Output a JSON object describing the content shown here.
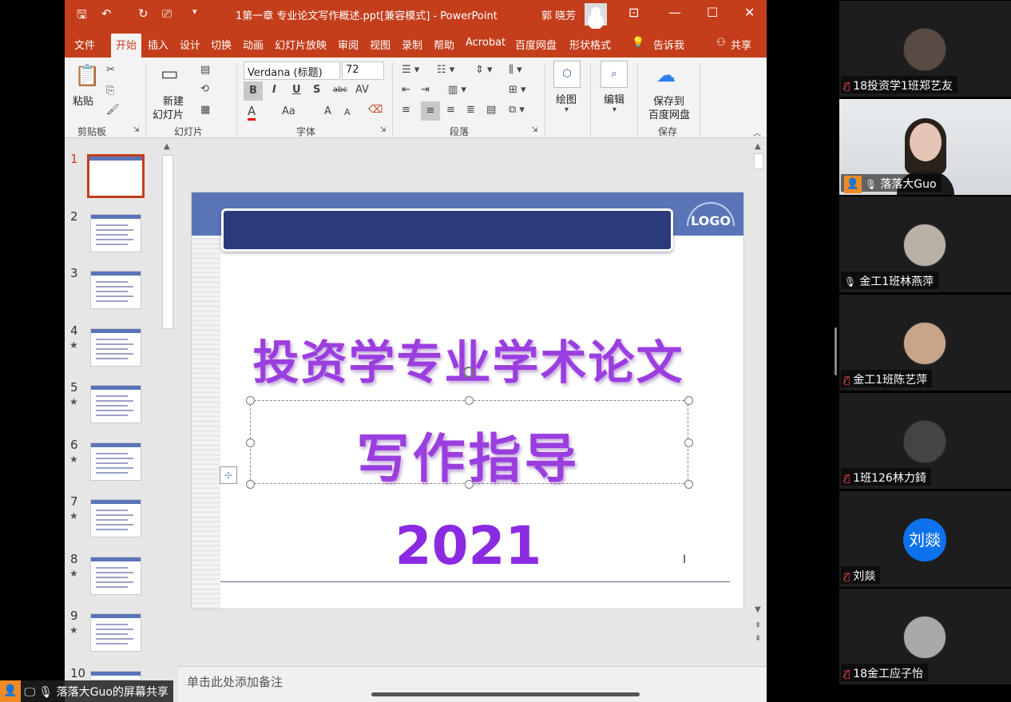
{
  "window": {
    "title": "1第一章 专业论文写作概述.ppt[兼容模式] - PowerPoint",
    "user_name": "郭 晓芳"
  },
  "ribbon_tabs": [
    "文件",
    "开始",
    "插入",
    "设计",
    "切换",
    "动画",
    "幻灯片放映",
    "审阅",
    "视图",
    "录制",
    "帮助",
    "Acrobat",
    "百度网盘",
    "形状格式"
  ],
  "tell_me": "告诉我",
  "share": "共享",
  "ribbon": {
    "clipboard": {
      "paste": "粘贴",
      "label": "剪贴板"
    },
    "slides": {
      "new_slide_line1": "新建",
      "new_slide_line2": "幻灯片",
      "label": "幻灯片"
    },
    "font": {
      "font_name": "Verdana (标题)",
      "font_size": "72",
      "bold": "B",
      "italic": "I",
      "underline": "U",
      "shadow": "S",
      "strike": "abc",
      "spacing": "AV",
      "color": "A",
      "case": "Aa",
      "grow": "A",
      "shrink": "A",
      "label": "字体"
    },
    "paragraph": {
      "label": "段落"
    },
    "drawing": {
      "label": "绘图"
    },
    "editing": {
      "label": "编辑"
    },
    "save": {
      "line1": "保存到",
      "line2": "百度网盘",
      "label": "保存"
    }
  },
  "thumbnails": [
    {
      "num": "1",
      "star": ""
    },
    {
      "num": "2",
      "star": ""
    },
    {
      "num": "3",
      "star": ""
    },
    {
      "num": "4",
      "star": "★"
    },
    {
      "num": "5",
      "star": "★"
    },
    {
      "num": "6",
      "star": "★"
    },
    {
      "num": "7",
      "star": "★"
    },
    {
      "num": "8",
      "star": "★"
    },
    {
      "num": "9",
      "star": "★"
    },
    {
      "num": "10",
      "star": ""
    }
  ],
  "slide": {
    "logo": "LOGO",
    "title": "投资学专业学术论文",
    "subtitle": "写作指导",
    "year": "2021"
  },
  "notes_placeholder": "单击此处添加备注",
  "participants": [
    {
      "name": "18投资学1班郑艺友",
      "muted": true,
      "type": "avatar",
      "avatar_color": "#5a4a44"
    },
    {
      "name": "落落大Guo",
      "muted": false,
      "type": "video",
      "host": true
    },
    {
      "name": "金工1班林燕萍",
      "muted": false,
      "type": "avatar",
      "avatar_color": "#b9b1a6"
    },
    {
      "name": "金工1班陈艺萍",
      "muted": true,
      "type": "avatar",
      "avatar_color": "#c8a488"
    },
    {
      "name": "1班126林力錡",
      "muted": true,
      "type": "avatar",
      "avatar_color": "#444"
    },
    {
      "name": "刘燚",
      "muted": true,
      "type": "initial",
      "initial": "刘燚"
    },
    {
      "name": "18金工应子怡",
      "muted": true,
      "type": "avatar",
      "avatar_color": "#a8a8a8"
    }
  ],
  "share_indicator": "落落大Guo的屏幕共享",
  "colors": {
    "ppt_accent": "#c43e1c",
    "slide_text": "#9b3ee0",
    "zoom_host": "#f08a24",
    "zoom_blue": "#0e72ed"
  }
}
